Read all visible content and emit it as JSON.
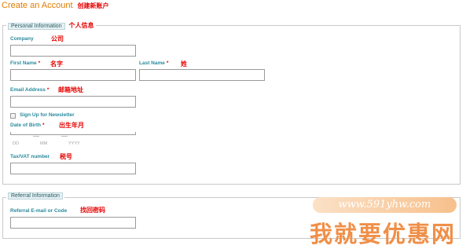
{
  "header": {
    "title": "Create an Account",
    "title_note": "创建新账户"
  },
  "personal": {
    "legend": "Personal Information",
    "legend_note": "个人信息",
    "company": {
      "label": "Company",
      "note": "公司",
      "value": ""
    },
    "first_name": {
      "label": "First Name",
      "required_mark": "*",
      "note": "名字",
      "value": ""
    },
    "last_name": {
      "label": "Last Name",
      "required_mark": "*",
      "note": "姓",
      "value": ""
    },
    "email": {
      "label": "Email Address",
      "required_mark": "*",
      "note": "邮箱地址",
      "value": ""
    },
    "newsletter": {
      "label": "Sign Up for Newsletter",
      "checked": false
    },
    "dob": {
      "label": "Date of Birth",
      "required_mark": "*",
      "note": "出生年月",
      "captions": [
        "DD",
        "MM",
        "YYYY"
      ]
    },
    "tax": {
      "label": "Tax/VAT number",
      "note": "税号",
      "value": ""
    }
  },
  "referral": {
    "legend": "Referral Information",
    "code": {
      "label": "Referral E-mail or Code",
      "note": "找回密码",
      "value": ""
    }
  },
  "watermark": {
    "url": "www.591yhw.com",
    "text": "我就要优惠网"
  }
}
